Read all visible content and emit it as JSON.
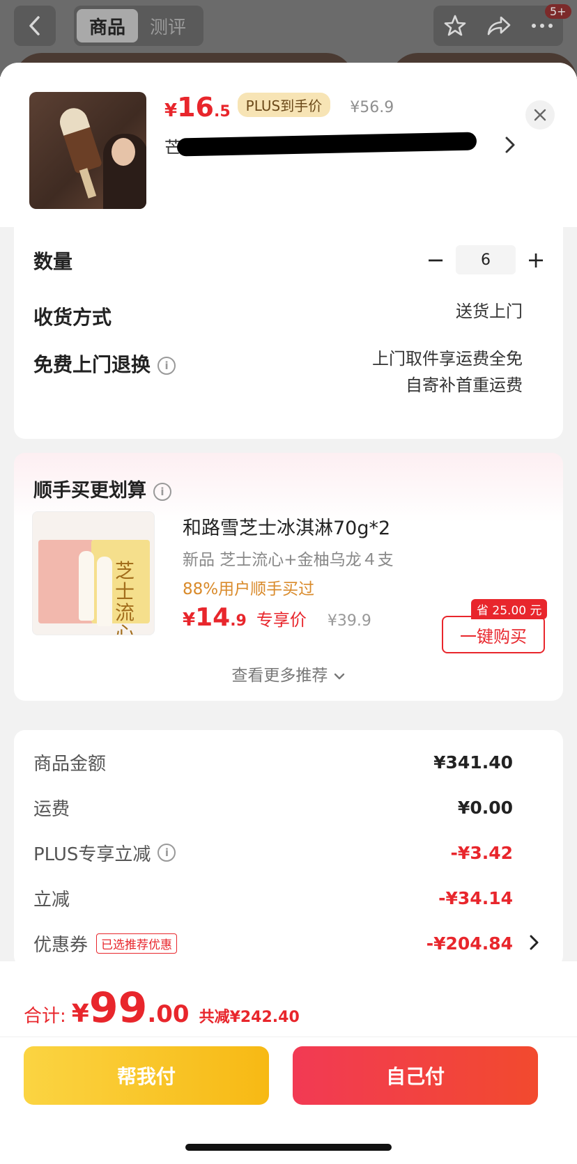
{
  "header": {
    "tabs": [
      {
        "label": "商品",
        "active": true
      },
      {
        "label": "测评",
        "active": false
      }
    ],
    "badge": "5+"
  },
  "product": {
    "price_yen": "¥",
    "price_int": "16",
    "price_dec": ".5",
    "plus_tag": "PLUS到手价",
    "orig_price": "¥56.9",
    "name": "芒 · 建"
  },
  "order": {
    "qty_label": "数量",
    "quantity": "6",
    "minus": "−",
    "plus": "+",
    "delivery_label": "收货方式",
    "delivery_value": "送货上门",
    "return_label": "免费上门退换",
    "return_value_line1": "上门取件享运费全免",
    "return_value_line2": "自寄补首重运费"
  },
  "upsell": {
    "title": "顺手买更划算",
    "name": "和路雪芝士冰淇淋70g*2",
    "subtitle": "新品 芝士流心+金柚乌龙４支",
    "buyers": "88%用户顺手买过",
    "price_yen": "¥",
    "price_int": "14",
    "price_dec": ".9",
    "price_tag": "专享价",
    "orig_price": "¥39.9",
    "save_tag": "省 25.00 元",
    "buy_label": "一键购买",
    "more_label": "查看更多推荐",
    "image_text": "芝士流心"
  },
  "summary": {
    "rows": [
      {
        "label": "商品金额",
        "value": "¥341.40"
      },
      {
        "label": "运费",
        "value": "¥0.00"
      },
      {
        "label": "PLUS专享立减",
        "value": "-¥3.42"
      },
      {
        "label": "立减",
        "value": "-¥34.14"
      },
      {
        "label": "优惠券",
        "value": "-¥204.84",
        "tag": "已选推荐优惠"
      }
    ]
  },
  "footer": {
    "total_label": "合计:",
    "total_yen": "¥",
    "total_int": "99",
    "total_dec": ".00",
    "total_save": "共减¥242.40",
    "help_pay": "帮我付",
    "self_pay": "自己付"
  },
  "colors": {
    "accent_red": "#e8262c",
    "plus_gold": "#f7e4b5",
    "help_btn": "#fbd442",
    "self_btn": "#f23a54"
  }
}
